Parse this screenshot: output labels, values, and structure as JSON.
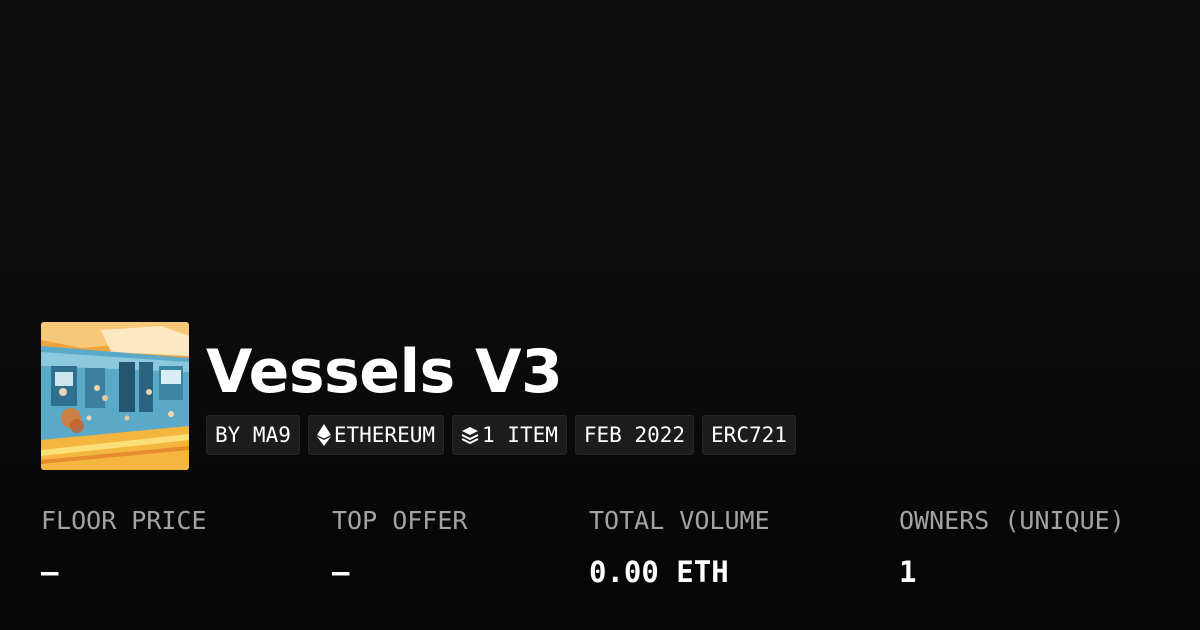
{
  "collection": {
    "title": "Vessels V3",
    "thumbnail_icon": "collection-artwork-image"
  },
  "tags": {
    "creator": "BY MA9",
    "chain": "ETHEREUM",
    "chain_icon": "ethereum-icon",
    "items": "1 ITEM",
    "items_icon": "stack-icon",
    "date": "FEB 2022",
    "standard": "ERC721"
  },
  "stats": {
    "floor_price": {
      "label": "FLOOR PRICE",
      "value": "–"
    },
    "top_offer": {
      "label": "TOP OFFER",
      "value": "–"
    },
    "total_volume": {
      "label": "TOTAL VOLUME",
      "value": "0.00 ETH"
    },
    "owners": {
      "label": "OWNERS (UNIQUE)",
      "value": "1"
    }
  },
  "colors": {
    "background": "#0b0b0b",
    "tag_background": "#1c1c1c",
    "label_gray": "#a3a3a3",
    "text": "#ffffff"
  }
}
